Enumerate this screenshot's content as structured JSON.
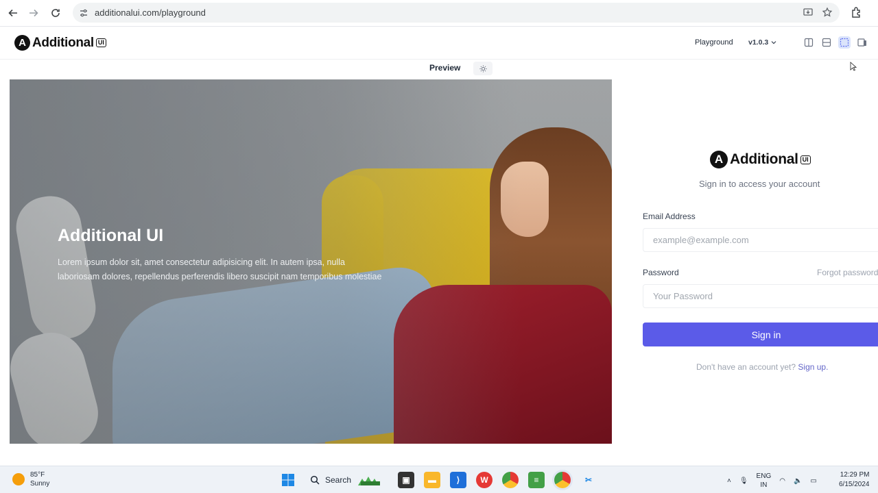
{
  "browser": {
    "url": "additionalui.com/playground"
  },
  "header": {
    "logo_text": "Additional",
    "logo_badge": "UI",
    "logo_mark": "A",
    "nav_link": "Playground",
    "version": "v1.0.3"
  },
  "preview": {
    "label": "Preview"
  },
  "hero": {
    "title": "Additional UI",
    "description": "Lorem ipsum dolor sit, amet consectetur adipisicing elit. In autem ipsa, nulla laboriosam dolores, repellendus perferendis libero suscipit nam temporibus molestiae"
  },
  "signin": {
    "logo_text": "Additional",
    "logo_badge": "UI",
    "logo_mark": "A",
    "subtitle": "Sign in to access your account",
    "email_label": "Email Address",
    "email_placeholder": "example@example.com",
    "password_label": "Password",
    "forgot_label": "Forgot password",
    "password_placeholder": "Your Password",
    "button_label": "Sign in",
    "signup_prompt": "Don't have an account yet?",
    "signup_link": "Sign up."
  },
  "taskbar": {
    "temperature": "85°F",
    "weather": "Sunny",
    "search_label": "Search",
    "language_top": "ENG",
    "language_bottom": "IN",
    "time": "12:29 PM",
    "date": "6/15/2024"
  },
  "colors": {
    "accent": "#5b5be8",
    "link": "#6366c8"
  }
}
